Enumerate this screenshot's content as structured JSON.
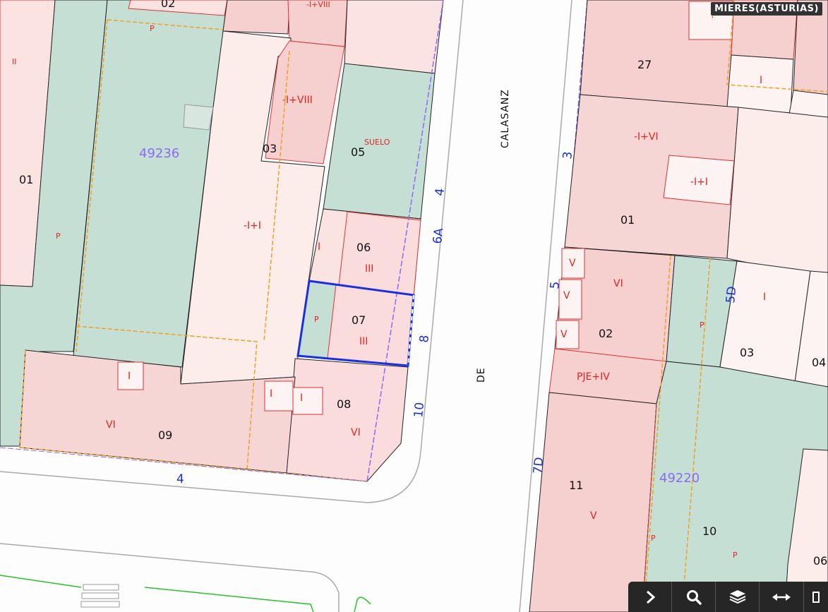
{
  "region_label": "MIERES(ASTURIAS)",
  "blocks": [
    {
      "id": "block-49236",
      "label": "49236"
    },
    {
      "id": "block-49220",
      "label": "49220"
    }
  ],
  "street_name": {
    "part1": "CALASANZ",
    "part2": "DE"
  },
  "house_numbers": [
    "4",
    "6A",
    "8",
    "10",
    "4",
    "3",
    "5",
    "5D",
    "7D"
  ],
  "parcel_labels": [
    "02",
    "27",
    "01",
    "05",
    "03",
    "01",
    "06",
    "07",
    "02",
    "03",
    "04",
    "08",
    "09",
    "11",
    "10",
    "06"
  ],
  "floor_labels": [
    "II",
    "-I+VIII",
    "-I+VIII",
    "-I+I",
    "SUELO",
    "I",
    "III",
    "III",
    "P",
    "P",
    "P",
    "I",
    "VI",
    "I",
    "I",
    "VI",
    "?",
    "I",
    "-I+VI",
    "-I+I",
    "V",
    "V",
    "V",
    "VI",
    "I",
    "P",
    "PJE+IV",
    "V",
    "P",
    "P"
  ],
  "toolbar": [
    {
      "name": "expand-chevron-icon"
    },
    {
      "name": "search-icon"
    },
    {
      "name": "layers-icon"
    },
    {
      "name": "measure-icon"
    }
  ]
}
